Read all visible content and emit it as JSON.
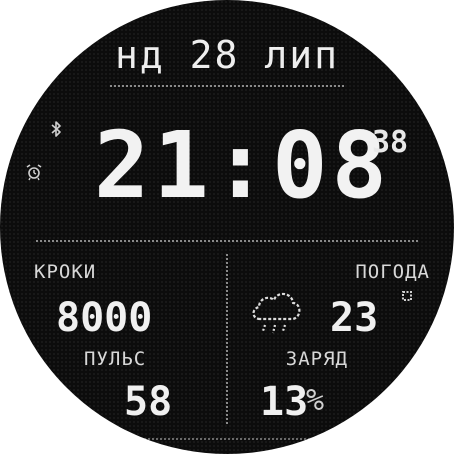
{
  "date": {
    "text": "нд 28 лип"
  },
  "time": {
    "hours_minutes": "21:08",
    "seconds": "38"
  },
  "status_icons": {
    "bluetooth": "bluetooth-icon",
    "alarm": "alarm-icon"
  },
  "steps": {
    "label": "КРОКИ",
    "value": "8000"
  },
  "pulse": {
    "label": "ПУЛЬС",
    "value": "58"
  },
  "weather": {
    "label": "ПОГОДА",
    "temperature": "23",
    "condition_icon": "rain-cloud-icon",
    "unit_icon": "degree-icon"
  },
  "battery": {
    "label": "ЗАРЯД",
    "value": "13",
    "unit": "%"
  },
  "colors": {
    "background": "#0c0c0c",
    "foreground": "#eeeeee",
    "divider": "#8a8a8a"
  }
}
